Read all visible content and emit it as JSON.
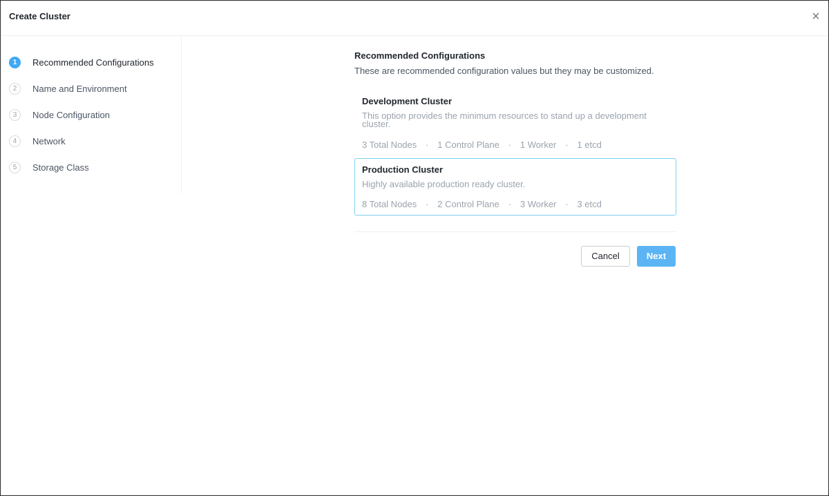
{
  "dialog": {
    "title": "Create Cluster",
    "close_symbol": "×"
  },
  "steps": [
    {
      "number": "1",
      "label": "Recommended Configurations",
      "active": true
    },
    {
      "number": "2",
      "label": "Name and Environment",
      "active": false
    },
    {
      "number": "3",
      "label": "Node Configuration",
      "active": false
    },
    {
      "number": "4",
      "label": "Network",
      "active": false
    },
    {
      "number": "5",
      "label": "Storage Class",
      "active": false
    }
  ],
  "section": {
    "title": "Recommended Configurations",
    "subtitle": "These are recommended configuration values but they may be customized."
  },
  "options": [
    {
      "title": "Development Cluster",
      "description": "This option provides the minimum resources to stand up a development cluster.",
      "stats": [
        "3 Total Nodes",
        "1 Control Plane",
        "1 Worker",
        "1 etcd"
      ],
      "selected": false
    },
    {
      "title": "Production Cluster",
      "description": "Highly available production ready cluster.",
      "stats": [
        "8 Total Nodes",
        "2 Control Plane",
        "3 Worker",
        "3 etcd"
      ],
      "selected": true
    }
  ],
  "stat_separator": "·",
  "buttons": {
    "cancel": "Cancel",
    "next": "Next"
  },
  "colors": {
    "accent": "#3fa9f5",
    "next_button": "#5bb4f3",
    "selected_border": "#7fd0ee"
  }
}
